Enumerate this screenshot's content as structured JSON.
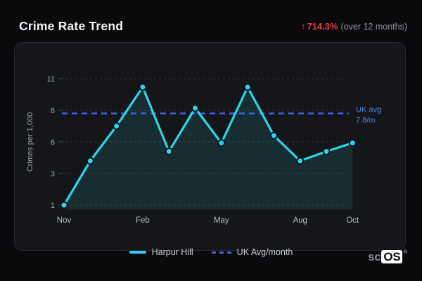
{
  "header": {
    "title": "Crime Rate Trend",
    "trend_arrow": "↑",
    "trend_value": "714.3%",
    "trend_caption": "(over 12 months)"
  },
  "chart_data": {
    "type": "line",
    "title": "Crime Rate Trend",
    "xlabel": "",
    "ylabel": "Crimes per 1,000",
    "y_ticks": [
      1,
      3,
      6,
      8,
      11
    ],
    "ylim": [
      1,
      11
    ],
    "grid": true,
    "n_points": 12,
    "x_ticks": [
      {
        "index": 0,
        "label": "Nov"
      },
      {
        "index": 3,
        "label": "Feb"
      },
      {
        "index": 6,
        "label": "May"
      },
      {
        "index": 9,
        "label": "Aug"
      },
      {
        "index": 11,
        "label": "Oct"
      }
    ],
    "series": [
      {
        "name": "Harpur Hill",
        "values": [
          1,
          4.2,
          7,
          10.2,
          5.1,
          8.2,
          5.9,
          10.2,
          6.4,
          4.2,
          5.1,
          5.9
        ]
      }
    ],
    "ref_line": {
      "value": 7.8,
      "label": [
        "UK avg",
        "7.8/m"
      ],
      "legend_label": "UK Avg/month"
    },
    "legend_position": "bottom"
  },
  "footer": {
    "brand_prefix": "sc",
    "brand_suffix": "OS",
    "registered_mark": "®"
  },
  "colors": {
    "page_bg": "#0a0a0d",
    "card_bg": "#15161a",
    "card_border": "#27282d",
    "series_cyan": "#2fd3e6",
    "area_fill": "rgba(47,211,230,0.12)",
    "ref_blue": "#3c63e4",
    "ref_label_blue": "#5582e0",
    "trend_red": "#e23d43",
    "title_text": "#f2f3f5",
    "muted_text": "#8f949c",
    "axis_text": "#9aa0a8",
    "month_text": "#b4bac2",
    "legend_text": "#c9cdd4",
    "grid_line": "#34373f",
    "marker_stroke": "#101419"
  }
}
